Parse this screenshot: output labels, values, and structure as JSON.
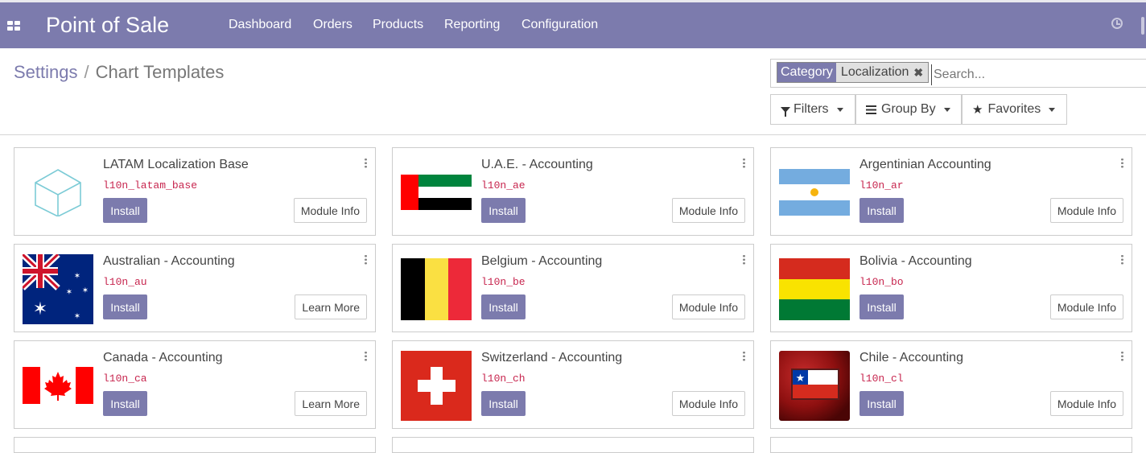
{
  "navbar": {
    "brand": "Point of Sale",
    "menu": [
      "Dashboard",
      "Orders",
      "Products",
      "Reporting",
      "Configuration"
    ]
  },
  "breadcrumb": {
    "parent": "Settings",
    "separator": "/",
    "current": "Chart Templates"
  },
  "search": {
    "facet_category": "Category",
    "facet_value": "Localization",
    "placeholder": "Search..."
  },
  "filters": {
    "filters_label": "Filters",
    "groupby_label": "Group By",
    "favorites_label": "Favorites"
  },
  "colors": {
    "primary": "#7c7bad",
    "tech_name": "#c7254e"
  },
  "modules": [
    {
      "title": "LATAM Localization Base",
      "tech": "l10n_latam_base",
      "install_label": "Install",
      "info_label": "Module Info",
      "icon": "cube-icon"
    },
    {
      "title": "U.A.E. - Accounting",
      "tech": "l10n_ae",
      "install_label": "Install",
      "info_label": "Module Info",
      "icon": "uae-flag-icon"
    },
    {
      "title": "Argentinian Accounting",
      "tech": "l10n_ar",
      "install_label": "Install",
      "info_label": "Module Info",
      "icon": "argentina-flag-icon"
    },
    {
      "title": "Australian - Accounting",
      "tech": "l10n_au",
      "install_label": "Install",
      "info_label": "Learn More",
      "icon": "australia-flag-icon"
    },
    {
      "title": "Belgium - Accounting",
      "tech": "l10n_be",
      "install_label": "Install",
      "info_label": "Module Info",
      "icon": "belgium-flag-icon"
    },
    {
      "title": "Bolivia - Accounting",
      "tech": "l10n_bo",
      "install_label": "Install",
      "info_label": "Module Info",
      "icon": "bolivia-flag-icon"
    },
    {
      "title": "Canada - Accounting",
      "tech": "l10n_ca",
      "install_label": "Install",
      "info_label": "Learn More",
      "icon": "canada-flag-icon"
    },
    {
      "title": "Switzerland - Accounting",
      "tech": "l10n_ch",
      "install_label": "Install",
      "info_label": "Module Info",
      "icon": "switzerland-flag-icon"
    },
    {
      "title": "Chile - Accounting",
      "tech": "l10n_cl",
      "install_label": "Install",
      "info_label": "Module Info",
      "icon": "chile-flag-icon"
    }
  ]
}
